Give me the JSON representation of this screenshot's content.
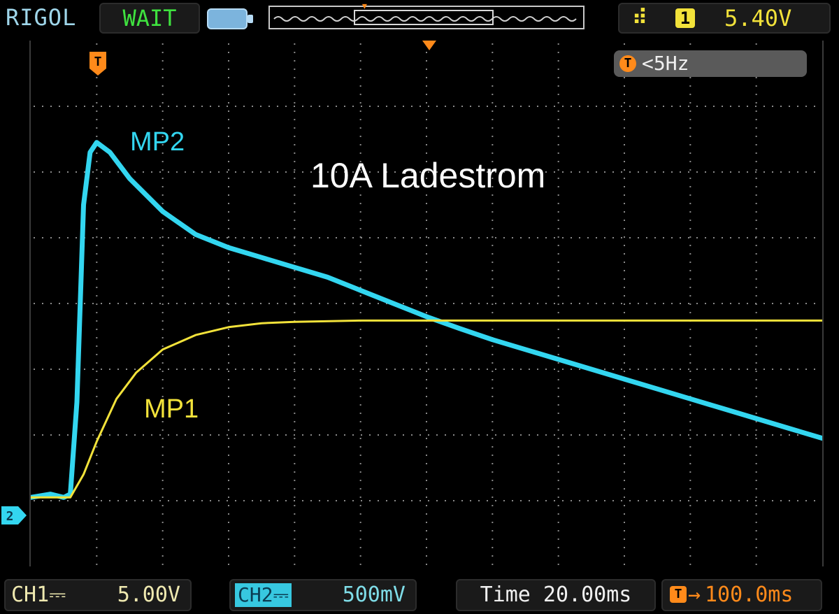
{
  "header": {
    "brand": "RIGOL",
    "run_status": "WAIT",
    "trigger_channel": "1",
    "trigger_level": "5.40V",
    "trigger_edge_icon": "rising-edge-icon"
  },
  "trigger_info": {
    "frequency": "<5Hz",
    "marker_letter": "T"
  },
  "annotations": {
    "title": "10A Ladestrom",
    "mp2": "MP2",
    "mp1": "MP1"
  },
  "footer": {
    "ch1_label": "CH1",
    "ch1_scale": "5.00V",
    "ch2_label": "CH2",
    "ch2_scale": "500mV",
    "time_label": "Time 20.00ms",
    "trigger_offset": "100.0ms"
  },
  "colors": {
    "ch1": "#f2e23a",
    "ch2": "#33d6f0",
    "trigger": "#ff8a1a",
    "grid": "#8a8a8a"
  },
  "chart_data": {
    "type": "line",
    "grid": true,
    "xlim": [
      0,
      12
    ],
    "ylim": [
      0,
      8
    ],
    "xlabel": "",
    "ylabel": "",
    "series": [
      {
        "name": "MP2",
        "points": [
          [
            0,
            1.05
          ],
          [
            0.3,
            1.1
          ],
          [
            0.5,
            1.05
          ],
          [
            0.6,
            1.1
          ],
          [
            0.7,
            2.5
          ],
          [
            0.8,
            5.5
          ],
          [
            0.9,
            6.3
          ],
          [
            1.0,
            6.45
          ],
          [
            1.2,
            6.3
          ],
          [
            1.5,
            5.9
          ],
          [
            2.0,
            5.4
          ],
          [
            2.5,
            5.05
          ],
          [
            3.0,
            4.85
          ],
          [
            3.5,
            4.7
          ],
          [
            4.0,
            4.55
          ],
          [
            4.5,
            4.4
          ],
          [
            5.0,
            4.2
          ],
          [
            5.5,
            4.0
          ],
          [
            6.0,
            3.8
          ],
          [
            6.5,
            3.62
          ],
          [
            7.0,
            3.45
          ],
          [
            7.5,
            3.3
          ],
          [
            8.0,
            3.15
          ],
          [
            8.5,
            3.0
          ],
          [
            9.0,
            2.85
          ],
          [
            9.5,
            2.7
          ],
          [
            10.0,
            2.55
          ],
          [
            10.5,
            2.4
          ],
          [
            11.0,
            2.25
          ],
          [
            11.5,
            2.1
          ],
          [
            12.0,
            1.95
          ]
        ]
      },
      {
        "name": "MP1",
        "points": [
          [
            0,
            1.05
          ],
          [
            0.6,
            1.05
          ],
          [
            0.8,
            1.4
          ],
          [
            1.0,
            1.9
          ],
          [
            1.3,
            2.55
          ],
          [
            1.6,
            2.95
          ],
          [
            2.0,
            3.3
          ],
          [
            2.5,
            3.52
          ],
          [
            3.0,
            3.64
          ],
          [
            3.5,
            3.7
          ],
          [
            4.0,
            3.72
          ],
          [
            5.0,
            3.74
          ],
          [
            6.0,
            3.74
          ],
          [
            8.0,
            3.74
          ],
          [
            10.0,
            3.74
          ],
          [
            12.0,
            3.74
          ]
        ]
      }
    ]
  }
}
